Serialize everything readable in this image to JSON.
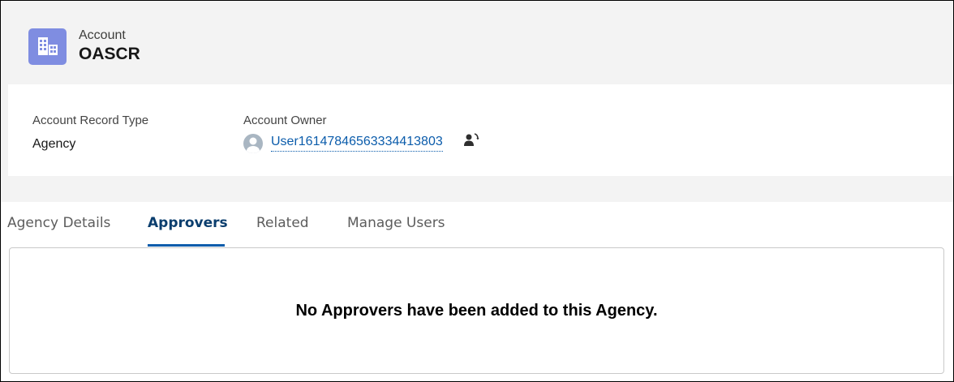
{
  "header": {
    "object_label": "Account",
    "record_name": "OASCR",
    "icon": "account-building-icon",
    "icon_color": "#7f8de1"
  },
  "highlights": {
    "fields": [
      {
        "label": "Account Record Type",
        "value": "Agency"
      },
      {
        "label": "Account Owner",
        "value": "User16147846563334413803"
      }
    ],
    "owner_avatar_icon": "user-avatar-icon",
    "change_owner_icon": "change-owner-icon"
  },
  "tabs": [
    {
      "label": "Agency Details",
      "active": false
    },
    {
      "label": "Approvers",
      "active": true
    },
    {
      "label": "Related",
      "active": false
    },
    {
      "label": "Manage Users",
      "active": false
    }
  ],
  "approvers": {
    "empty_message": "No Approvers have been added to this Agency."
  },
  "colors": {
    "link": "#0b5cab",
    "active_tab": "#0b3e6e",
    "background": "#f3f3f3"
  }
}
